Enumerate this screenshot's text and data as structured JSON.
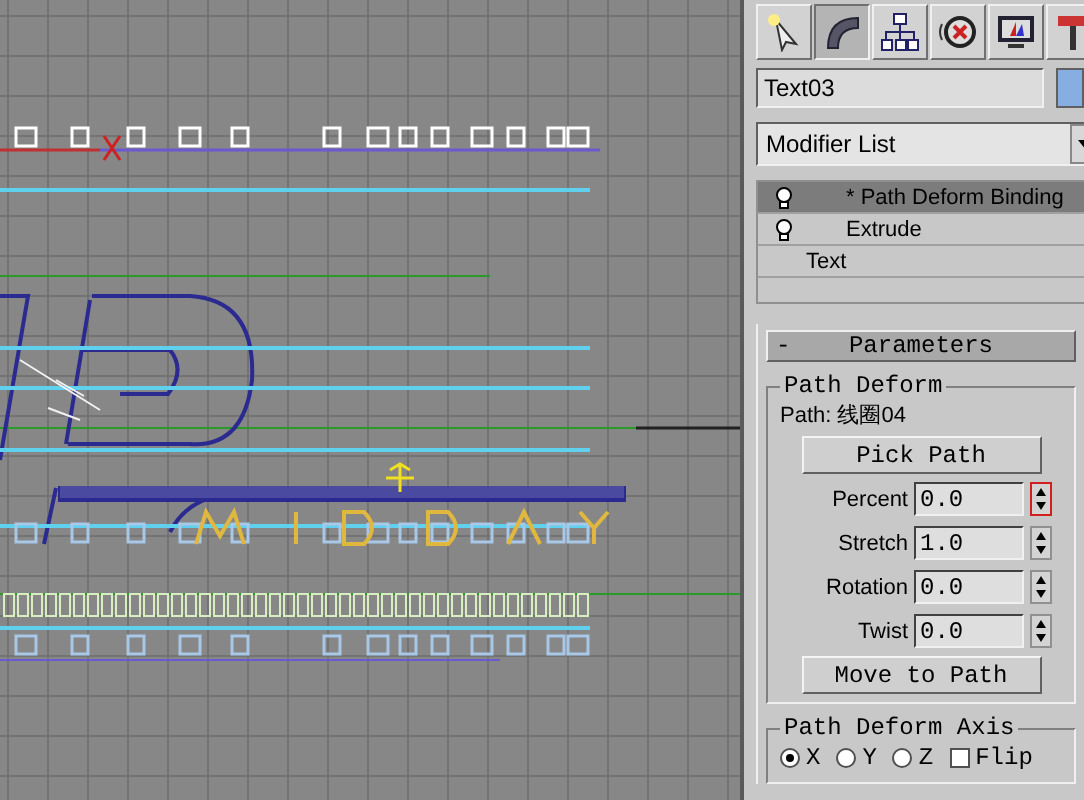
{
  "command_tabs": [
    {
      "kind": "create",
      "selected": false
    },
    {
      "kind": "modify",
      "selected": true
    },
    {
      "kind": "hierarchy",
      "selected": false
    },
    {
      "kind": "motion",
      "selected": false
    },
    {
      "kind": "display",
      "selected": false
    },
    {
      "kind": "utilities",
      "selected": false
    }
  ],
  "object_name": "Text03",
  "modifier_list": "Modifier List",
  "modifier_stack": [
    {
      "label": "* Path Deform Binding",
      "bulb": true,
      "selected": true
    },
    {
      "label": "Extrude",
      "bulb": true,
      "selected": false
    },
    {
      "label": "Text",
      "bulb": false,
      "selected": false
    }
  ],
  "rollout": {
    "title": "Parameters",
    "collapse_sign": "-",
    "group": "Path Deform",
    "path": "Path: 线圈04",
    "pick_button": "Pick Path",
    "spinners": [
      {
        "label": "Percent",
        "value": "0.0",
        "active": true
      },
      {
        "label": "Stretch",
        "value": "1.0",
        "active": false
      },
      {
        "label": "Rotation",
        "value": "0.0",
        "active": false
      },
      {
        "label": "Twist",
        "value": "0.0",
        "active": false
      }
    ],
    "move_button": "Move to Path",
    "axis_group": "Path Deform Axis",
    "axes": [
      {
        "label": "X",
        "selected": true
      },
      {
        "label": "Y",
        "selected": false
      },
      {
        "label": "Z",
        "selected": false
      }
    ],
    "flip": {
      "label": "Flip",
      "checked": false
    }
  }
}
